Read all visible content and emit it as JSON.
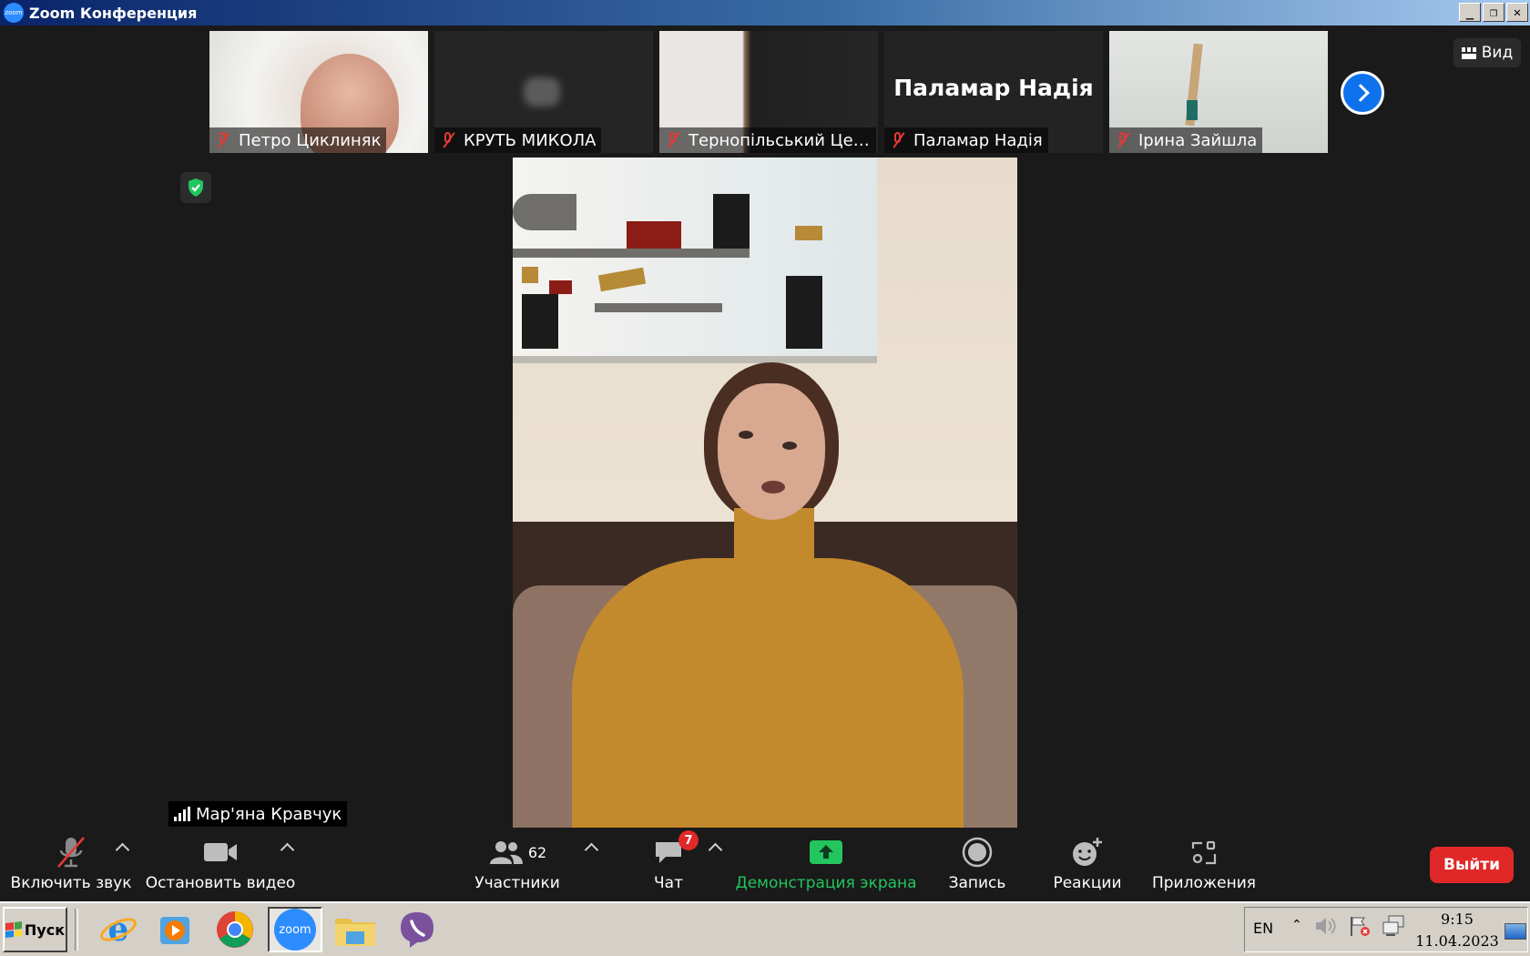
{
  "window": {
    "title": "Zoom Конференция",
    "logo_text": "zoom"
  },
  "participants": [
    {
      "name": "Петро Циклиняк",
      "muted": true
    },
    {
      "name": "КРУТЬ МИКОЛА",
      "muted": true
    },
    {
      "name": "Тернопільський Цент...",
      "muted": true
    },
    {
      "name": "Паламар Надія",
      "muted": true,
      "display_text": "Паламар Надія"
    },
    {
      "name": "Ірина Зайшла",
      "muted": true
    }
  ],
  "view_button": {
    "label": "Вид"
  },
  "active_speaker": {
    "name": "Мар'яна Кравчук"
  },
  "toolbar": {
    "unmute": "Включить звук",
    "stop_video": "Остановить видео",
    "participants": "Участники",
    "participants_count": "62",
    "chat": "Чат",
    "chat_badge": "7",
    "share_screen": "Демонстрация экрана",
    "record": "Запись",
    "reactions": "Реакции",
    "apps": "Приложения",
    "leave": "Выйти"
  },
  "taskbar": {
    "start": "Пуск",
    "apps": [
      "internet-explorer-icon",
      "media-player-icon",
      "chrome-icon",
      "zoom-icon",
      "file-explorer-icon",
      "viber-icon"
    ],
    "zoom_label": "zoom",
    "language": "EN",
    "time": "9:15",
    "date": "11.04.2023"
  },
  "colors": {
    "accent_blue": "#0e72ed",
    "share_green": "#22c55e",
    "leave_red": "#e02828",
    "mute_red": "#e53935"
  }
}
